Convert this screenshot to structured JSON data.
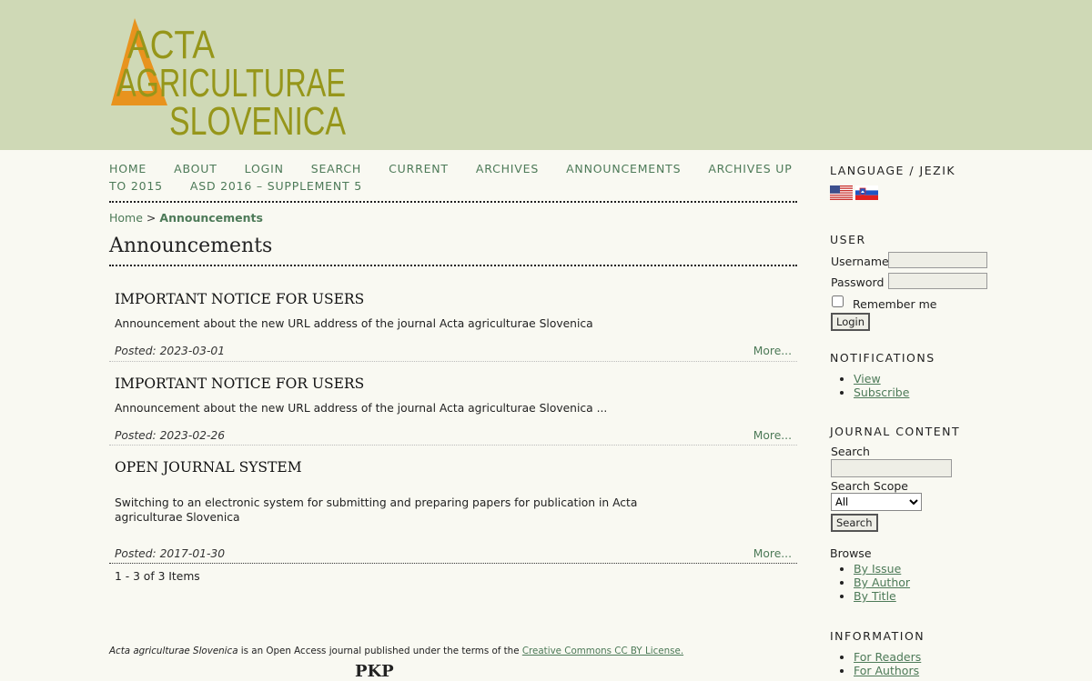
{
  "colors": {
    "header_bg": "#cfd9b6",
    "page_bg": "#f9f9f2",
    "link": "#4d7a58",
    "logo_olive": "#96961a",
    "logo_orange": "#e8931e"
  },
  "logo": {
    "line1": "ACTA",
    "line2": "AGRICULTURAE",
    "line3": "SLOVENICA"
  },
  "nav": {
    "items": [
      "HOME",
      "ABOUT",
      "LOGIN",
      "SEARCH",
      "CURRENT",
      "ARCHIVES",
      "ANNOUNCEMENTS",
      "ARCHIVES UP TO 2015",
      "ASD 2016 – SUPPLEMENT 5"
    ]
  },
  "breadcrumb": {
    "home": "Home",
    "separator": ">",
    "current": "Announcements"
  },
  "page": {
    "title": "Announcements"
  },
  "announcements": [
    {
      "title": "IMPORTANT NOTICE FOR USERS",
      "description": "Announcement about the new URL address of the journal Acta agriculturae Slovenica",
      "posted": "Posted: 2023-03-01",
      "more": "More..."
    },
    {
      "title": "IMPORTANT NOTICE FOR USERS",
      "description": "Announcement about the new URL address of the journal Acta agriculturae Slovenica ...",
      "posted": "Posted: 2023-02-26",
      "more": "More..."
    },
    {
      "title": "OPEN JOURNAL SYSTEM",
      "description": "Switching to an electronic system for submitting and preparing papers for publication in Acta agriculturae Slovenica",
      "posted": "Posted: 2017-01-30",
      "more": "More..."
    }
  ],
  "pagination": {
    "text": "1 - 3 of 3 Items"
  },
  "footer": {
    "journal_name": "Acta agriculturae Slovenica",
    "text": " is an Open Access journal published under the terms of the ",
    "license": "Creative Commons CC BY License.",
    "logo_text": "PKP"
  },
  "sidebar": {
    "language": {
      "title": "LANGUAGE / JEZIK",
      "flags": [
        "us-flag-icon",
        "slovenia-flag-icon"
      ]
    },
    "user": {
      "title": "USER",
      "username_label": "Username",
      "password_label": "Password",
      "remember_label": "Remember me",
      "login_button": "Login"
    },
    "notifications": {
      "title": "NOTIFICATIONS",
      "items": [
        "View",
        "Subscribe"
      ]
    },
    "journal_content": {
      "title": "JOURNAL CONTENT",
      "search_label": "Search",
      "scope_label": "Search Scope",
      "scope_selected": "All",
      "search_button": "Search",
      "browse_label": "Browse",
      "browse_items": [
        "By Issue",
        "By Author",
        "By Title"
      ]
    },
    "information": {
      "title": "INFORMATION",
      "items": [
        "For Readers",
        "For Authors"
      ]
    }
  }
}
